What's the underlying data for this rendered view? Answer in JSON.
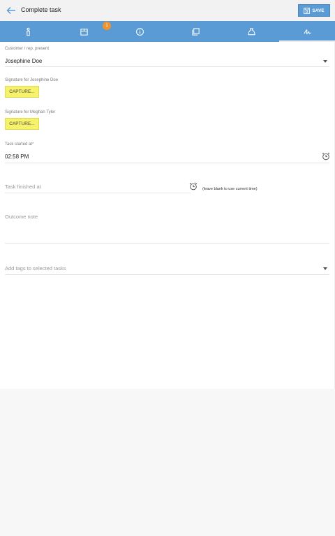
{
  "header": {
    "title": "Complete task",
    "save_label": "SAVE"
  },
  "tabs": [
    {
      "id": "info",
      "icon": "person-icon"
    },
    {
      "id": "box",
      "icon": "box-icon",
      "badge": "1"
    },
    {
      "id": "details",
      "icon": "info-circle-icon"
    },
    {
      "id": "copies",
      "icon": "copy-icon"
    },
    {
      "id": "bag",
      "icon": "bag-icon"
    },
    {
      "id": "signature",
      "icon": "signature-icon",
      "active": true
    }
  ],
  "form": {
    "customer_label": "Customer / rep. present",
    "customer_value": "Josephine Doe",
    "sig1_label": "Signature for Josephine Doe",
    "sig1_button": "CAPTURE...",
    "sig2_label": "Signature for Meghan Tyler",
    "sig2_button": "CAPTURE...",
    "started_label": "Task started at*",
    "started_value": "02:58 PM",
    "finished_placeholder": "Task finished at",
    "finished_note": "(leave blank to use current time)",
    "outcome_placeholder": "Outcome note",
    "tags_placeholder": "Add tags to selected tasks"
  },
  "colors": {
    "accent": "#5b9bd5",
    "capture": "#f7f26b",
    "badge": "#f0932b"
  }
}
